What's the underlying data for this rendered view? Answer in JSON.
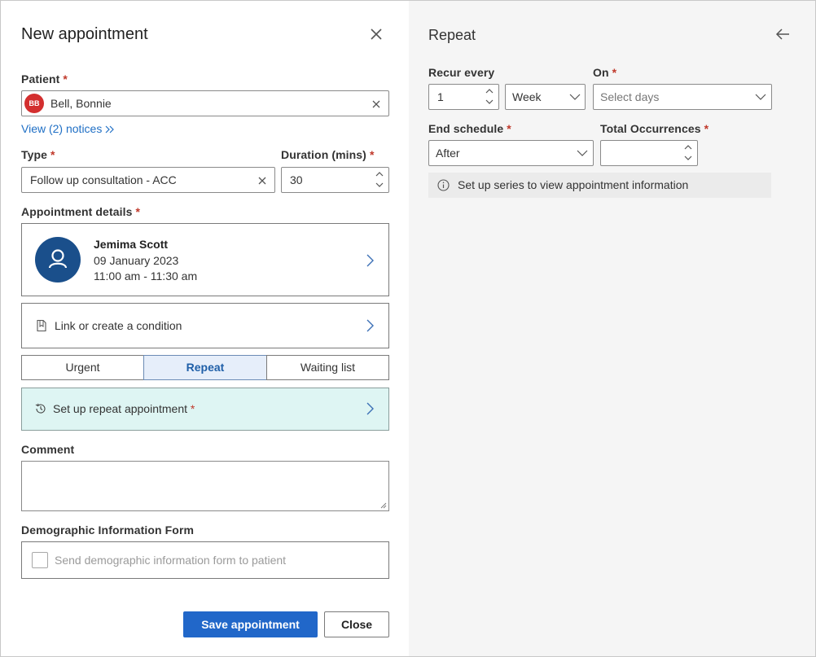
{
  "dialog": {
    "title": "New appointment"
  },
  "patient": {
    "label": "Patient",
    "required_mark": "*",
    "initials": "BB",
    "name": "Bell, Bonnie",
    "notices_link": "View (2) notices"
  },
  "type": {
    "label": "Type",
    "required_mark": "*",
    "value": "Follow up consultation - ACC"
  },
  "duration": {
    "label": "Duration (mins)",
    "required_mark": "*",
    "value": "30"
  },
  "appointment_details": {
    "label": "Appointment details",
    "required_mark": "*",
    "practitioner": "Jemima Scott",
    "date": "09 January 2023",
    "time": "11:00 am - 11:30 am"
  },
  "condition": {
    "label": "Link or create a condition"
  },
  "segments": [
    {
      "label": "Urgent",
      "active": false
    },
    {
      "label": "Repeat",
      "active": true
    },
    {
      "label": "Waiting list",
      "active": false
    }
  ],
  "repeat_setup": {
    "label": "Set up repeat appointment",
    "required_mark": "*"
  },
  "comment": {
    "label": "Comment",
    "value": ""
  },
  "demographic": {
    "label": "Demographic Information Form",
    "checkbox_label": "Send demographic information form to patient",
    "checked": false
  },
  "footer": {
    "save_label": "Save appointment",
    "close_label": "Close"
  },
  "repeat_panel": {
    "title": "Repeat",
    "recur_every_label": "Recur every",
    "recur_every_value": "1",
    "period_value": "Week",
    "on_label": "On",
    "on_required_mark": "*",
    "on_placeholder": "Select days",
    "end_schedule_label": "End schedule",
    "end_schedule_required_mark": "*",
    "end_schedule_value": "After",
    "total_occurrences_label": "Total Occurrences",
    "total_occurrences_required_mark": "*",
    "total_occurrences_value": "",
    "info_text": "Set up series to view appointment information"
  },
  "colors": {
    "primary": "#2167c9",
    "link": "#1f6fc5",
    "required": "#c0392b",
    "avatar_patient": "#d32f2f",
    "avatar_practitioner": "#1a4f8b",
    "repeat_bar_bg": "#def5f3",
    "segment_active_bg": "#e6eefa"
  }
}
